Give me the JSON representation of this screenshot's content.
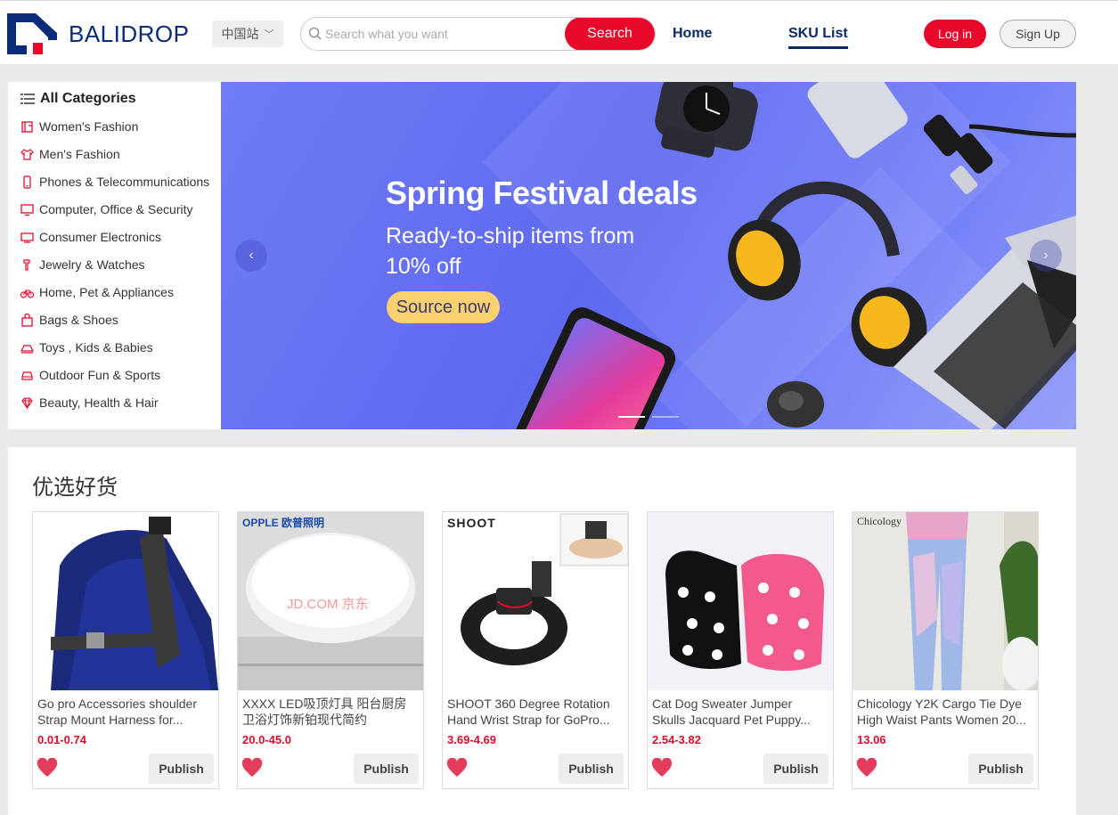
{
  "header": {
    "logo_text": "BALIDROP",
    "site_selector": "中国站",
    "search": {
      "placeholder": "Search what you want",
      "button": "Search"
    },
    "nav": {
      "home": "Home",
      "sku_list": "SKU List"
    },
    "login": "Log in",
    "signup": "Sign Up"
  },
  "sidebar": {
    "title": "All Categories",
    "items": [
      {
        "label": "Women's Fashion",
        "icon": "dress-icon"
      },
      {
        "label": "Men's Fashion",
        "icon": "shirt-icon"
      },
      {
        "label": "Phones & Telecommunications",
        "icon": "phone-icon"
      },
      {
        "label": "Computer, Office & Security",
        "icon": "monitor-icon"
      },
      {
        "label": "Consumer Electronics",
        "icon": "tv-icon"
      },
      {
        "label": "Jewelry & Watches",
        "icon": "ring-icon"
      },
      {
        "label": "Home, Pet & Appliances",
        "icon": "bicycle-icon"
      },
      {
        "label": "Bags & Shoes",
        "icon": "bag-icon"
      },
      {
        "label": "Toys , Kids & Babies",
        "icon": "toy-icon"
      },
      {
        "label": "Outdoor Fun & Sports",
        "icon": "car-icon"
      },
      {
        "label": "Beauty, Health & Hair",
        "icon": "diamond-icon"
      }
    ]
  },
  "banner": {
    "title": "Spring Festival deals",
    "subtitle": "Ready-to-ship items from 10% off",
    "cta": "Source now",
    "slides": 2,
    "active_slide": 1
  },
  "products": {
    "section_title": "优选好货",
    "publish_label": "Publish",
    "items": [
      {
        "name_line1": "Go pro Accessories shoulder",
        "name_line2": "Strap Mount Harness for...",
        "price": "0.01-0.74",
        "image": "harness-photo"
      },
      {
        "name_line1": "XXXX LED吸顶灯具 阳台厨房",
        "name_line2": "卫浴灯饰新铂现代简约",
        "price": "20.0-45.0",
        "image": "ceiling-lamp-photo",
        "brand": "OPPLE 欧普照明",
        "watermark": "JD.COM 京东"
      },
      {
        "name_line1": "SHOOT 360 Degree Rotation",
        "name_line2": "Hand Wrist Strap for GoPro...",
        "price": "3.69-4.69",
        "image": "wrist-strap-photo",
        "brand": "SHOOT"
      },
      {
        "name_line1": "Cat Dog Sweater Jumper",
        "name_line2": "Skulls Jacquard Pet Puppy...",
        "price": "2.54-3.82",
        "image": "pet-sweater-photo"
      },
      {
        "name_line1": "Chicology Y2K Cargo Tie Dye",
        "name_line2": "High Waist Pants Women 20...",
        "price": "13.06",
        "image": "pants-photo",
        "brand": "Chicology"
      }
    ]
  },
  "colors": {
    "brand_red": "#e8082a",
    "navy": "#0a2a6a",
    "banner_blue": "#6570f2",
    "price_red": "#d80d2a"
  }
}
